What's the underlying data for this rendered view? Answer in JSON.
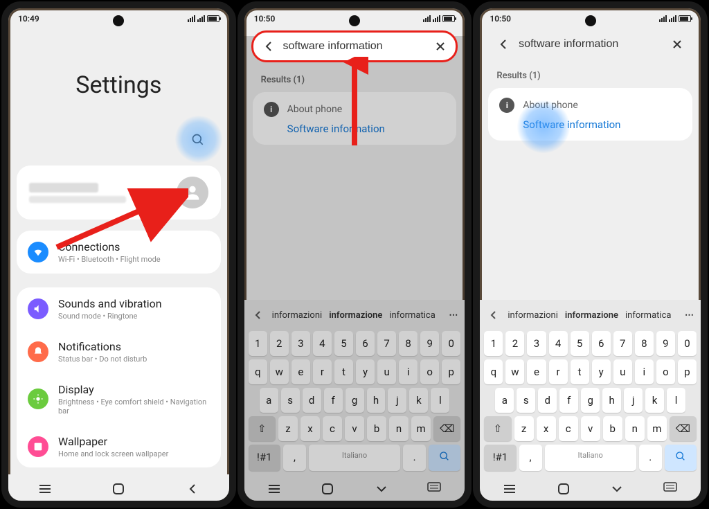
{
  "status": {
    "time1": "10:49",
    "time2": "10:50",
    "time3": "10:50",
    "icons": "⬚ ✱ ✕ ⊙"
  },
  "phone1": {
    "title": "Settings",
    "items": [
      {
        "title": "Connections",
        "sub": "Wi-Fi • Bluetooth • Flight mode"
      },
      {
        "title": "Sounds and vibration",
        "sub": "Sound mode • Ringtone"
      },
      {
        "title": "Notifications",
        "sub": "Status bar • Do not disturb"
      },
      {
        "title": "Display",
        "sub": "Brightness • Eye comfort shield • Navigation bar"
      },
      {
        "title": "Wallpaper",
        "sub": "Home and lock screen wallpaper"
      }
    ]
  },
  "search": {
    "query": "software information",
    "results_label": "Results (1)",
    "about": "About phone",
    "link": "Software information"
  },
  "keyboard": {
    "suggestions": [
      "informazioni",
      "informazione",
      "informatica"
    ],
    "row1": [
      "1",
      "2",
      "3",
      "4",
      "5",
      "6",
      "7",
      "8",
      "9",
      "0"
    ],
    "row2": [
      "q",
      "w",
      "e",
      "r",
      "t",
      "y",
      "u",
      "i",
      "o",
      "p"
    ],
    "row3": [
      "a",
      "s",
      "d",
      "f",
      "g",
      "h",
      "j",
      "k",
      "l"
    ],
    "row4": [
      "z",
      "x",
      "c",
      "v",
      "b",
      "n",
      "m"
    ],
    "sym": "!#1",
    "lang": "Italiano"
  }
}
